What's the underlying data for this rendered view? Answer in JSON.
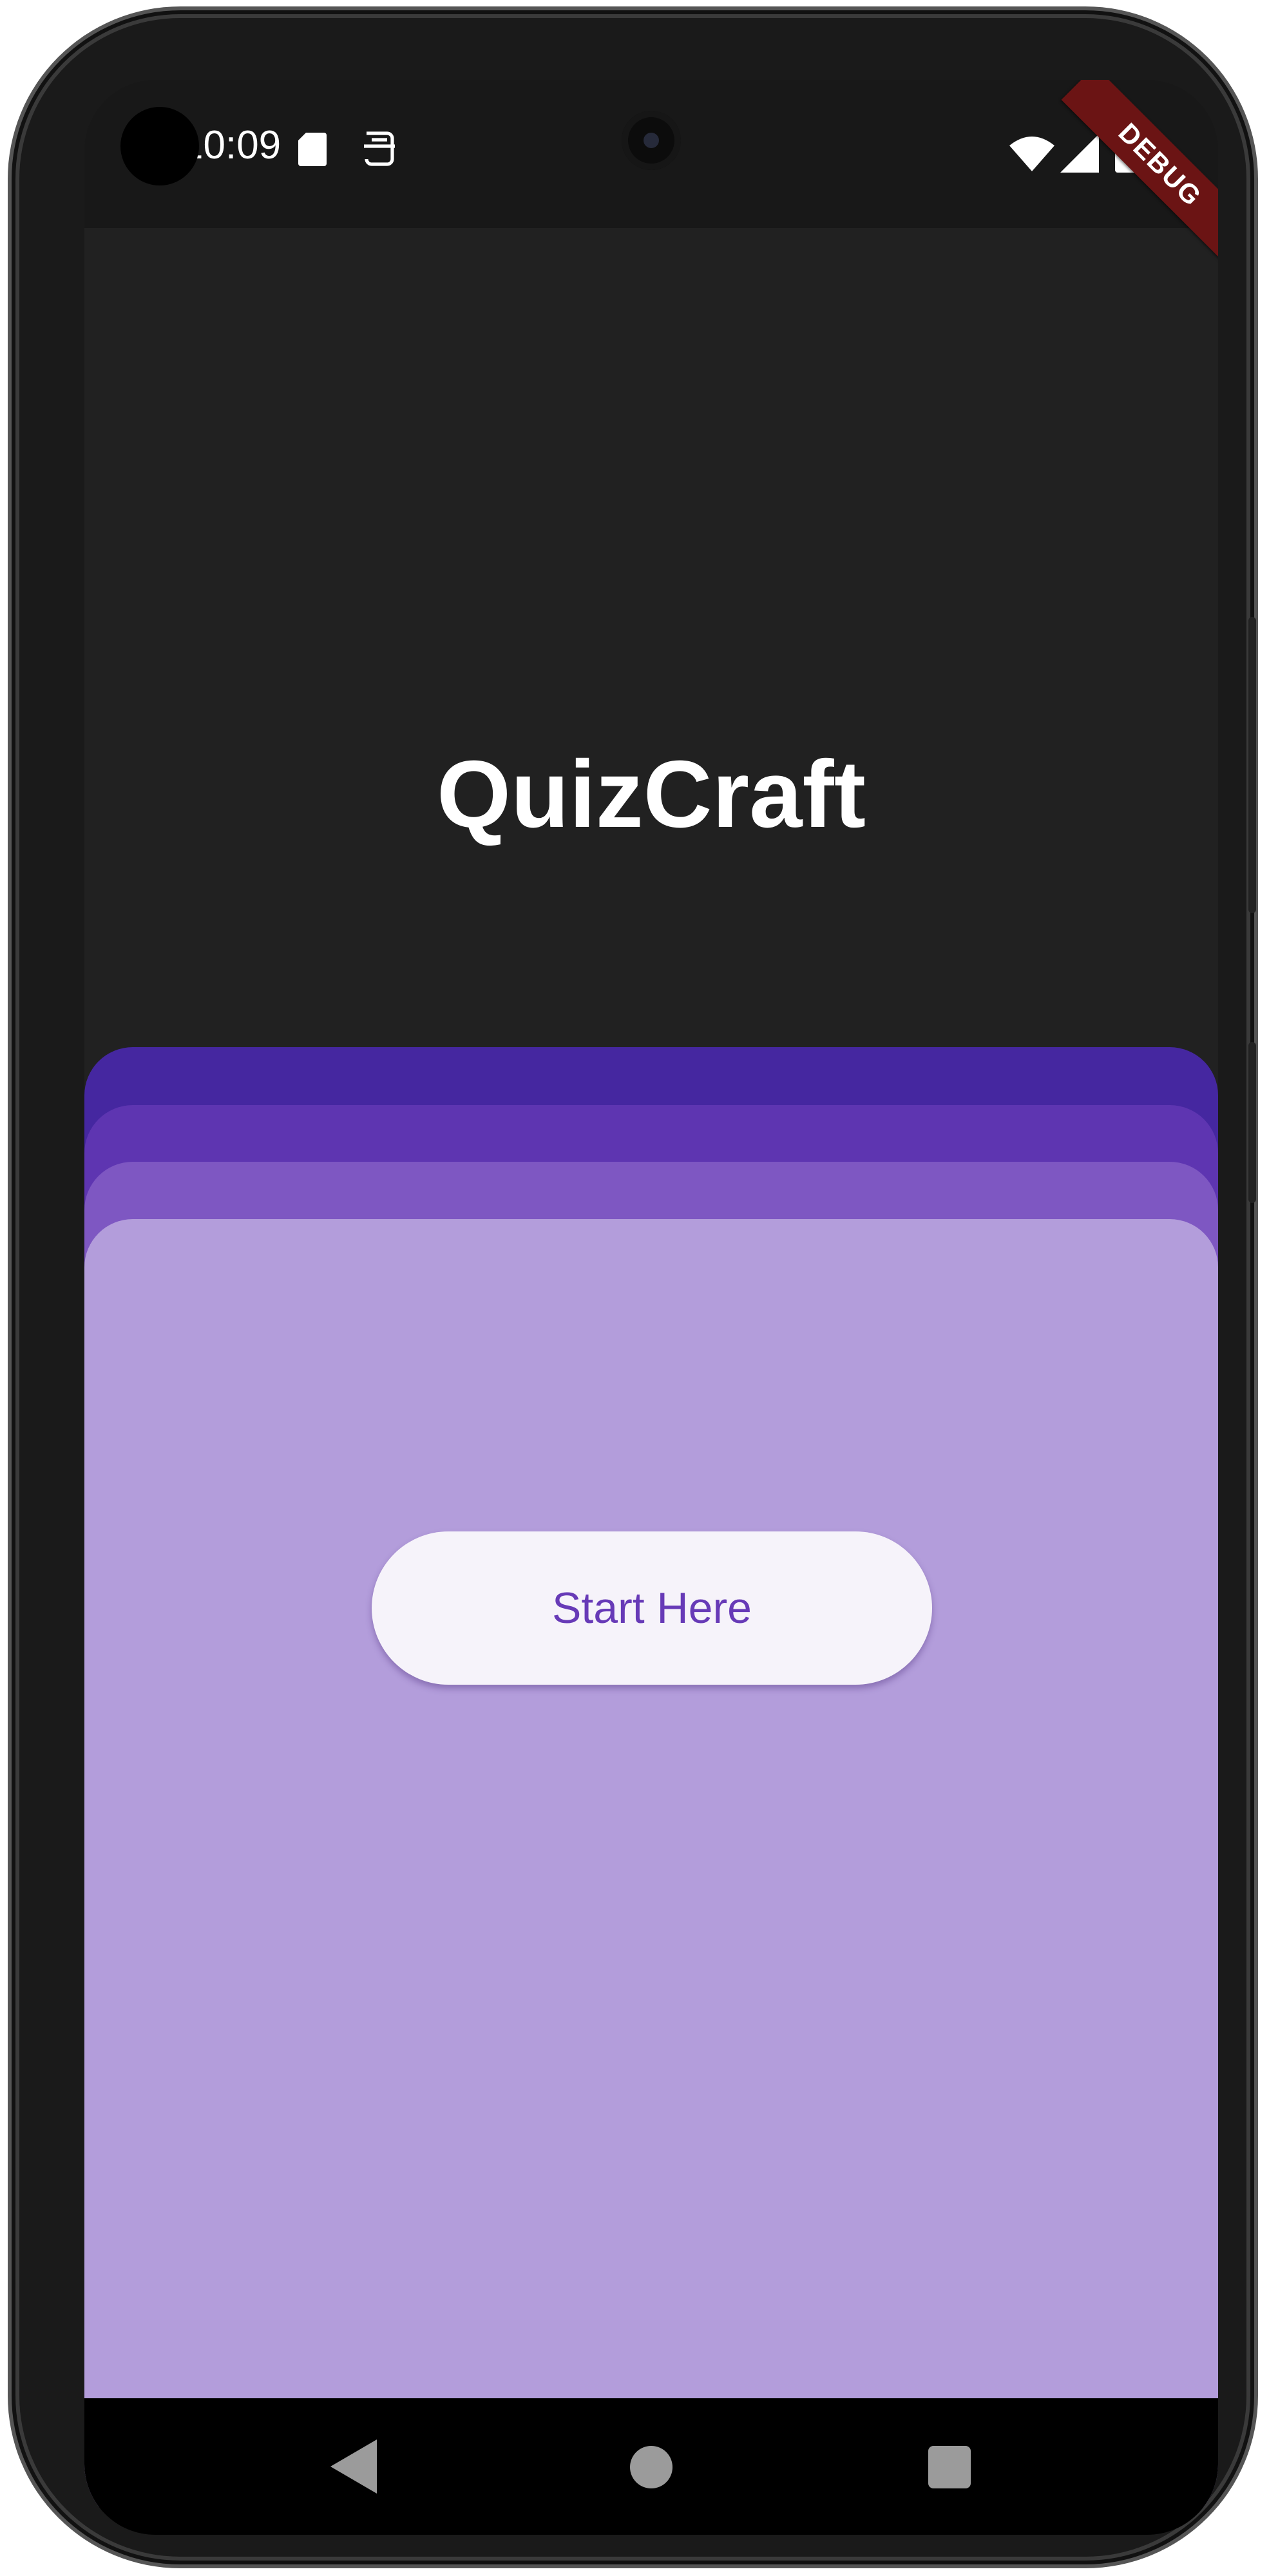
{
  "status_bar": {
    "time": "10:09",
    "icons": [
      "sd-card-icon",
      "wallet-icon",
      "wifi-icon",
      "cell-signal-icon",
      "battery-icon"
    ]
  },
  "debug_banner": "DEBUG",
  "app": {
    "title": "QuizCraft",
    "start_button_label": "Start Here"
  },
  "navigation": {
    "buttons": [
      "back-icon",
      "home-icon",
      "recents-icon"
    ]
  },
  "colors": {
    "background": "#212121",
    "card_1": "#4527a0",
    "card_2": "#5e35b1",
    "card_3": "#7e57c2",
    "card_main": "#b39ddb",
    "button_bg": "#f6f3fa",
    "button_text": "#673ab7",
    "debug_banner": "#6b1414"
  }
}
